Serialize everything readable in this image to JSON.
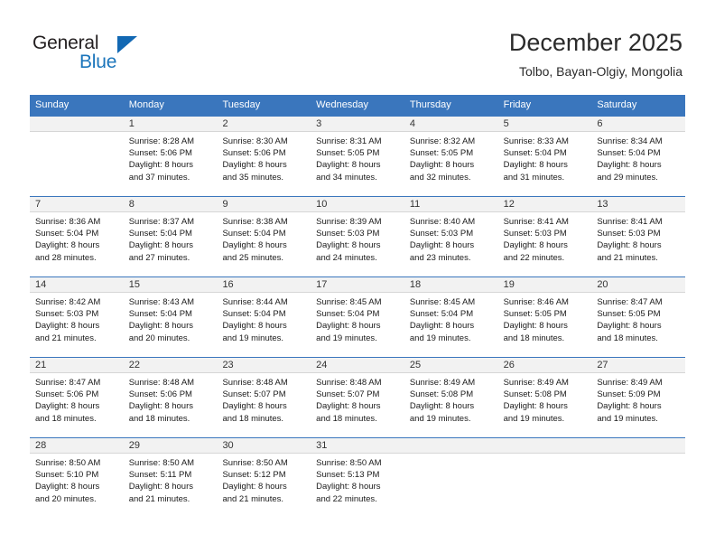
{
  "brand": {
    "name_part1": "General",
    "name_part2": "Blue",
    "triangle_icon": "triangle-icon",
    "accent_color": "#1b75bb"
  },
  "header": {
    "title": "December 2025",
    "subtitle": "Tolbo, Bayan-Olgiy, Mongolia"
  },
  "calendar": {
    "header_color": "#3a76bd",
    "weekdays": [
      "Sunday",
      "Monday",
      "Tuesday",
      "Wednesday",
      "Thursday",
      "Friday",
      "Saturday"
    ],
    "weeks": [
      [
        {
          "day": "",
          "lines": []
        },
        {
          "day": "1",
          "lines": [
            "Sunrise: 8:28 AM",
            "Sunset: 5:06 PM",
            "Daylight: 8 hours",
            "and 37 minutes."
          ]
        },
        {
          "day": "2",
          "lines": [
            "Sunrise: 8:30 AM",
            "Sunset: 5:06 PM",
            "Daylight: 8 hours",
            "and 35 minutes."
          ]
        },
        {
          "day": "3",
          "lines": [
            "Sunrise: 8:31 AM",
            "Sunset: 5:05 PM",
            "Daylight: 8 hours",
            "and 34 minutes."
          ]
        },
        {
          "day": "4",
          "lines": [
            "Sunrise: 8:32 AM",
            "Sunset: 5:05 PM",
            "Daylight: 8 hours",
            "and 32 minutes."
          ]
        },
        {
          "day": "5",
          "lines": [
            "Sunrise: 8:33 AM",
            "Sunset: 5:04 PM",
            "Daylight: 8 hours",
            "and 31 minutes."
          ]
        },
        {
          "day": "6",
          "lines": [
            "Sunrise: 8:34 AM",
            "Sunset: 5:04 PM",
            "Daylight: 8 hours",
            "and 29 minutes."
          ]
        }
      ],
      [
        {
          "day": "7",
          "lines": [
            "Sunrise: 8:36 AM",
            "Sunset: 5:04 PM",
            "Daylight: 8 hours",
            "and 28 minutes."
          ]
        },
        {
          "day": "8",
          "lines": [
            "Sunrise: 8:37 AM",
            "Sunset: 5:04 PM",
            "Daylight: 8 hours",
            "and 27 minutes."
          ]
        },
        {
          "day": "9",
          "lines": [
            "Sunrise: 8:38 AM",
            "Sunset: 5:04 PM",
            "Daylight: 8 hours",
            "and 25 minutes."
          ]
        },
        {
          "day": "10",
          "lines": [
            "Sunrise: 8:39 AM",
            "Sunset: 5:03 PM",
            "Daylight: 8 hours",
            "and 24 minutes."
          ]
        },
        {
          "day": "11",
          "lines": [
            "Sunrise: 8:40 AM",
            "Sunset: 5:03 PM",
            "Daylight: 8 hours",
            "and 23 minutes."
          ]
        },
        {
          "day": "12",
          "lines": [
            "Sunrise: 8:41 AM",
            "Sunset: 5:03 PM",
            "Daylight: 8 hours",
            "and 22 minutes."
          ]
        },
        {
          "day": "13",
          "lines": [
            "Sunrise: 8:41 AM",
            "Sunset: 5:03 PM",
            "Daylight: 8 hours",
            "and 21 minutes."
          ]
        }
      ],
      [
        {
          "day": "14",
          "lines": [
            "Sunrise: 8:42 AM",
            "Sunset: 5:03 PM",
            "Daylight: 8 hours",
            "and 21 minutes."
          ]
        },
        {
          "day": "15",
          "lines": [
            "Sunrise: 8:43 AM",
            "Sunset: 5:04 PM",
            "Daylight: 8 hours",
            "and 20 minutes."
          ]
        },
        {
          "day": "16",
          "lines": [
            "Sunrise: 8:44 AM",
            "Sunset: 5:04 PM",
            "Daylight: 8 hours",
            "and 19 minutes."
          ]
        },
        {
          "day": "17",
          "lines": [
            "Sunrise: 8:45 AM",
            "Sunset: 5:04 PM",
            "Daylight: 8 hours",
            "and 19 minutes."
          ]
        },
        {
          "day": "18",
          "lines": [
            "Sunrise: 8:45 AM",
            "Sunset: 5:04 PM",
            "Daylight: 8 hours",
            "and 19 minutes."
          ]
        },
        {
          "day": "19",
          "lines": [
            "Sunrise: 8:46 AM",
            "Sunset: 5:05 PM",
            "Daylight: 8 hours",
            "and 18 minutes."
          ]
        },
        {
          "day": "20",
          "lines": [
            "Sunrise: 8:47 AM",
            "Sunset: 5:05 PM",
            "Daylight: 8 hours",
            "and 18 minutes."
          ]
        }
      ],
      [
        {
          "day": "21",
          "lines": [
            "Sunrise: 8:47 AM",
            "Sunset: 5:06 PM",
            "Daylight: 8 hours",
            "and 18 minutes."
          ]
        },
        {
          "day": "22",
          "lines": [
            "Sunrise: 8:48 AM",
            "Sunset: 5:06 PM",
            "Daylight: 8 hours",
            "and 18 minutes."
          ]
        },
        {
          "day": "23",
          "lines": [
            "Sunrise: 8:48 AM",
            "Sunset: 5:07 PM",
            "Daylight: 8 hours",
            "and 18 minutes."
          ]
        },
        {
          "day": "24",
          "lines": [
            "Sunrise: 8:48 AM",
            "Sunset: 5:07 PM",
            "Daylight: 8 hours",
            "and 18 minutes."
          ]
        },
        {
          "day": "25",
          "lines": [
            "Sunrise: 8:49 AM",
            "Sunset: 5:08 PM",
            "Daylight: 8 hours",
            "and 19 minutes."
          ]
        },
        {
          "day": "26",
          "lines": [
            "Sunrise: 8:49 AM",
            "Sunset: 5:08 PM",
            "Daylight: 8 hours",
            "and 19 minutes."
          ]
        },
        {
          "day": "27",
          "lines": [
            "Sunrise: 8:49 AM",
            "Sunset: 5:09 PM",
            "Daylight: 8 hours",
            "and 19 minutes."
          ]
        }
      ],
      [
        {
          "day": "28",
          "lines": [
            "Sunrise: 8:50 AM",
            "Sunset: 5:10 PM",
            "Daylight: 8 hours",
            "and 20 minutes."
          ]
        },
        {
          "day": "29",
          "lines": [
            "Sunrise: 8:50 AM",
            "Sunset: 5:11 PM",
            "Daylight: 8 hours",
            "and 21 minutes."
          ]
        },
        {
          "day": "30",
          "lines": [
            "Sunrise: 8:50 AM",
            "Sunset: 5:12 PM",
            "Daylight: 8 hours",
            "and 21 minutes."
          ]
        },
        {
          "day": "31",
          "lines": [
            "Sunrise: 8:50 AM",
            "Sunset: 5:13 PM",
            "Daylight: 8 hours",
            "and 22 minutes."
          ]
        },
        {
          "day": "",
          "lines": []
        },
        {
          "day": "",
          "lines": []
        },
        {
          "day": "",
          "lines": []
        }
      ]
    ]
  }
}
